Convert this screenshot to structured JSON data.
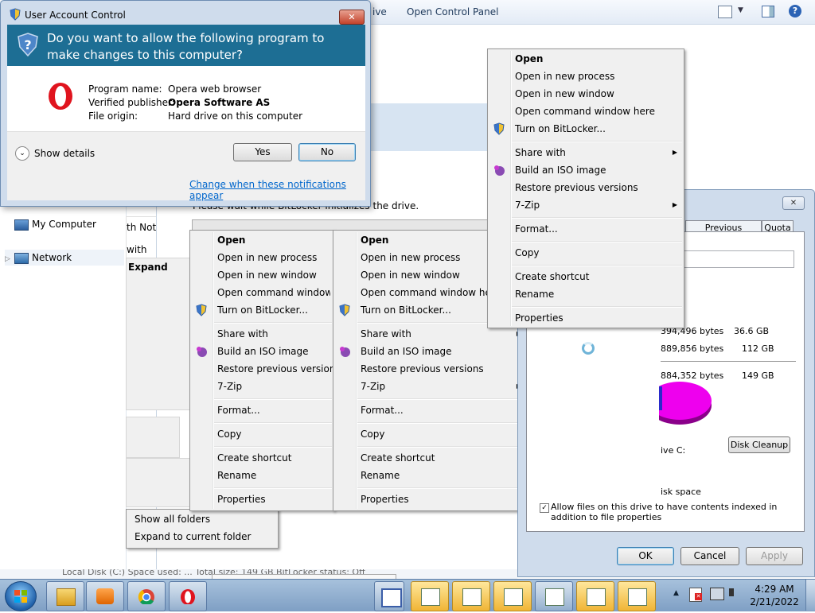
{
  "explorer": {
    "cmd_partial": "ive",
    "cmd_open_cp": "Open Control Panel",
    "nav": {
      "my_computer": "My Computer",
      "network": "Network"
    },
    "partial_col": "th Not",
    "partial_with": "with",
    "expand": "Expand",
    "bitlocker_status": "Please wait while BitLocker initializes the drive.",
    "status_bar": "Local Disk (C:)   Space used: ...   Total size: 149 GB   BitLocker status: Off"
  },
  "uac": {
    "title": "User Account Control",
    "question": "Do you want to allow the following program to make changes to this computer?",
    "program_name_label": "Program name:",
    "program_name": "Opera web browser",
    "publisher_label": "Verified publisher:",
    "publisher": "Opera Software AS",
    "origin_label": "File origin:",
    "origin": "Hard drive on this computer",
    "show_details": "Show details",
    "yes": "Yes",
    "no": "No",
    "change_link": "Change when these notifications appear"
  },
  "context_menu": {
    "open": "Open",
    "open_new_process": "Open in new process",
    "open_new_window": "Open in new window",
    "open_cmd_here": "Open command window here",
    "open_cmd_trunc": "Open command window he",
    "bitlocker": "Turn on BitLocker...",
    "share_with": "Share with",
    "build_iso": "Build an ISO image",
    "restore": "Restore previous versions",
    "seven_zip": "7-Zip",
    "format": "Format...",
    "copy": "Copy",
    "create_shortcut": "Create shortcut",
    "rename": "Rename",
    "properties": "Properties"
  },
  "folder_menu": {
    "show_all": "Show all folders",
    "expand_current": "Expand to current folder"
  },
  "properties": {
    "tab_prev": "Previous Versions",
    "tab_quota": "Quota",
    "used_bytes": "394,496 bytes",
    "used_gb": "36.6 GB",
    "free_bytes": "889,856 bytes",
    "free_gb": "112 GB",
    "cap_bytes": "884,352 bytes",
    "cap_gb": "149 GB",
    "drive_label": "ive C:",
    "disk_cleanup": "Disk Cleanup",
    "compress_partial": "isk space",
    "index_label": "Allow files on this drive to have contents indexed in addition to file properties",
    "ok": "OK",
    "cancel": "Cancel",
    "apply": "Apply"
  },
  "clock": {
    "time": "4:29 AM",
    "date": "2/21/2022"
  },
  "colors": {
    "uac_banner": "#1d6e94",
    "pie_used": "#2a2acb",
    "pie_free": "#ee00ee",
    "taskbar": "#8fadd0"
  }
}
